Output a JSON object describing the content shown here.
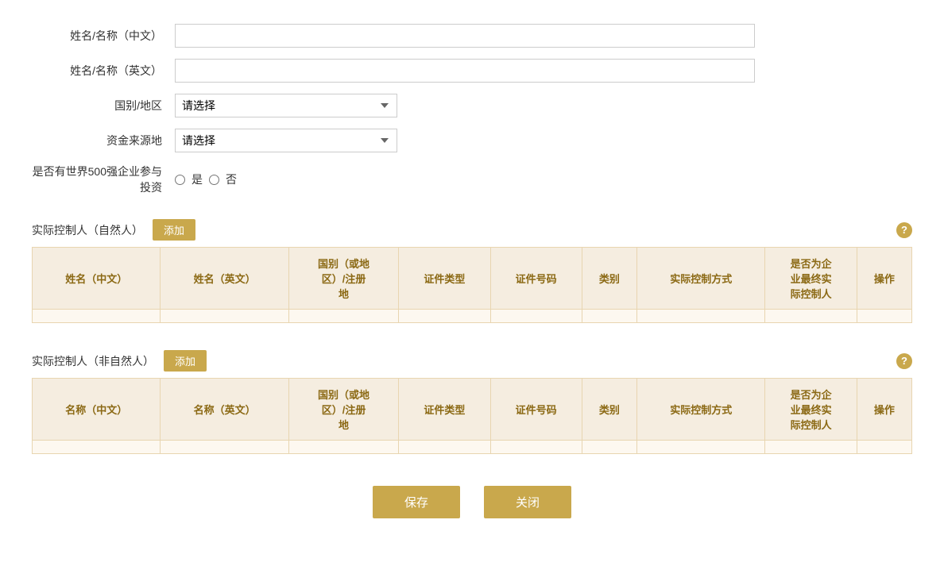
{
  "form": {
    "name_cn_label": "姓名/名称（中文）",
    "name_en_label": "姓名/名称（英文）",
    "country_label": "国别/地区",
    "fund_source_label": "资金来源地",
    "fortune500_label": "是否有世界500强企业参与投资",
    "name_cn_value": "",
    "name_en_value": "",
    "country_placeholder": "请选择",
    "fund_source_placeholder": "请选择",
    "fortune500_yes": "是",
    "fortune500_no": "否"
  },
  "natural_person": {
    "section_title": "实际控制人（自然人）",
    "add_label": "添加",
    "help_icon": "?",
    "columns": [
      "姓名（中文）",
      "姓名（英文）",
      "国别（或地区）/注册地",
      "证件类型",
      "证件号码",
      "类别",
      "实际控制方式",
      "是否为企业最终实际控制人",
      "操作"
    ]
  },
  "non_natural_person": {
    "section_title": "实际控制人（非自然人）",
    "add_label": "添加",
    "help_icon": "?",
    "columns": [
      "名称（中文）",
      "名称（英文）",
      "国别（或地区）/注册地",
      "证件类型",
      "证件号码",
      "类别",
      "实际控制方式",
      "是否为企业最终实际控制人",
      "操作"
    ]
  },
  "buttons": {
    "save": "保存",
    "close": "关闭"
  },
  "help": "?"
}
